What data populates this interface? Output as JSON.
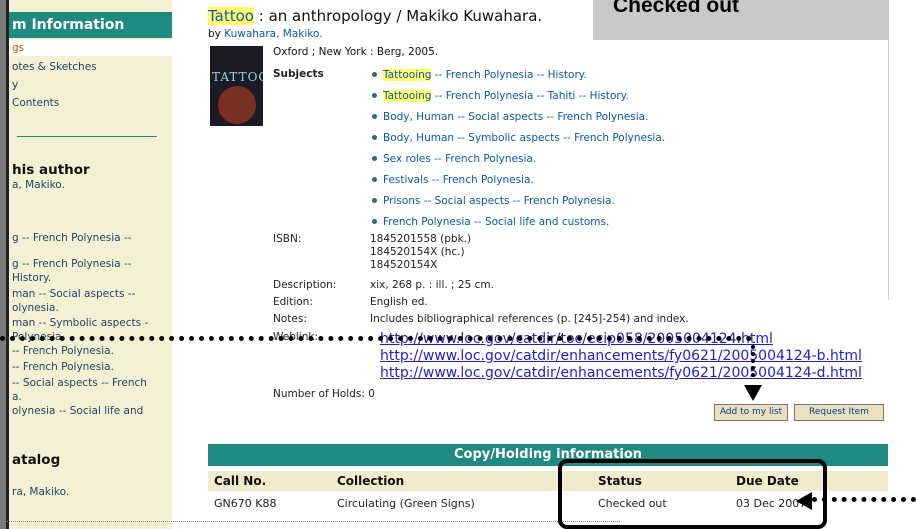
{
  "sidebar": {
    "header": "m Information",
    "items": [
      {
        "label": "gs"
      },
      {
        "label": "otes & Sketches"
      },
      {
        "label": "y"
      },
      {
        "label": "Contents"
      }
    ],
    "author_heading": "his author",
    "author_link": "a, Makiko.",
    "subject_lines": [
      "g -- French Polynesia --",
      "g -- French Polynesia --",
      "History.",
      "man -- Social aspects --",
      "olynesia.",
      "man -- Symbolic aspects -",
      "Polynesia.",
      "-- French Polynesia.",
      "-- French Polynesia.",
      "-- Social aspects -- French",
      "a.",
      "olynesia -- Social life and"
    ],
    "catalog_heading": "atalog",
    "catalog_link": "ra, Makiko."
  },
  "record": {
    "title_main": "Tattoo",
    "title_rest": " : an anthropology / Makiko Kuwahara.",
    "by_prefix": "by ",
    "author": "Kuwahara, Makiko.",
    "cover_text": "TATTOO",
    "publication": "Oxford ; New York : Berg, 2005.",
    "subjects_label": "Subjects",
    "subjects": [
      {
        "hl": "Tattooing",
        "rest": " -- French Polynesia -- History."
      },
      {
        "hl": "Tattooing",
        "rest": " -- French Polynesia -- Tahiti -- History."
      },
      {
        "hl": "",
        "rest": "Body, Human -- Social aspects -- French Polynesia."
      },
      {
        "hl": "",
        "rest": "Body, Human -- Symbolic aspects -- French Polynesia."
      },
      {
        "hl": "",
        "rest": "Sex roles -- French Polynesia."
      },
      {
        "hl": "",
        "rest": "Festivals -- French Polynesia."
      },
      {
        "hl": "",
        "rest": "Prisons -- Social aspects -- French Polynesia."
      },
      {
        "hl": "",
        "rest": "French Polynesia -- Social life and customs."
      }
    ],
    "isbn_label": "ISBN:",
    "isbns": [
      "1845201558 (pbk.)",
      "184520154X (hc.)",
      "184520154X"
    ],
    "description_label": "Description:",
    "description": "xix, 268 p. : ill. ; 25 cm.",
    "edition_label": "Edition:",
    "edition": "English ed.",
    "notes_label": "Notes:",
    "notes": "Includes bibliographical references (p. [245]-254) and index.",
    "weblink_label": "Weblink:",
    "weblinks": [
      "http://www.loc.gov/catdir/toc/ecip058/2005004124.html",
      "http://www.loc.gov/catdir/enhancements/fy0621/2005004124-b.html",
      "http://www.loc.gov/catdir/enhancements/fy0621/2005004124-d.html"
    ],
    "holds_label": "Number of Holds:",
    "holds": "0",
    "add_button": "Add to my list",
    "request_button": "Request Item"
  },
  "holdings": {
    "title": "Copy/Holding information",
    "columns": [
      "Call No.",
      "Collection",
      "Status",
      "Due Date"
    ],
    "rows": [
      [
        "GN670 K88",
        "Circulating (Green Signs)",
        "Checked out",
        "03 Dec 2007"
      ]
    ]
  },
  "annotation": {
    "callout_text": "Checked out"
  }
}
